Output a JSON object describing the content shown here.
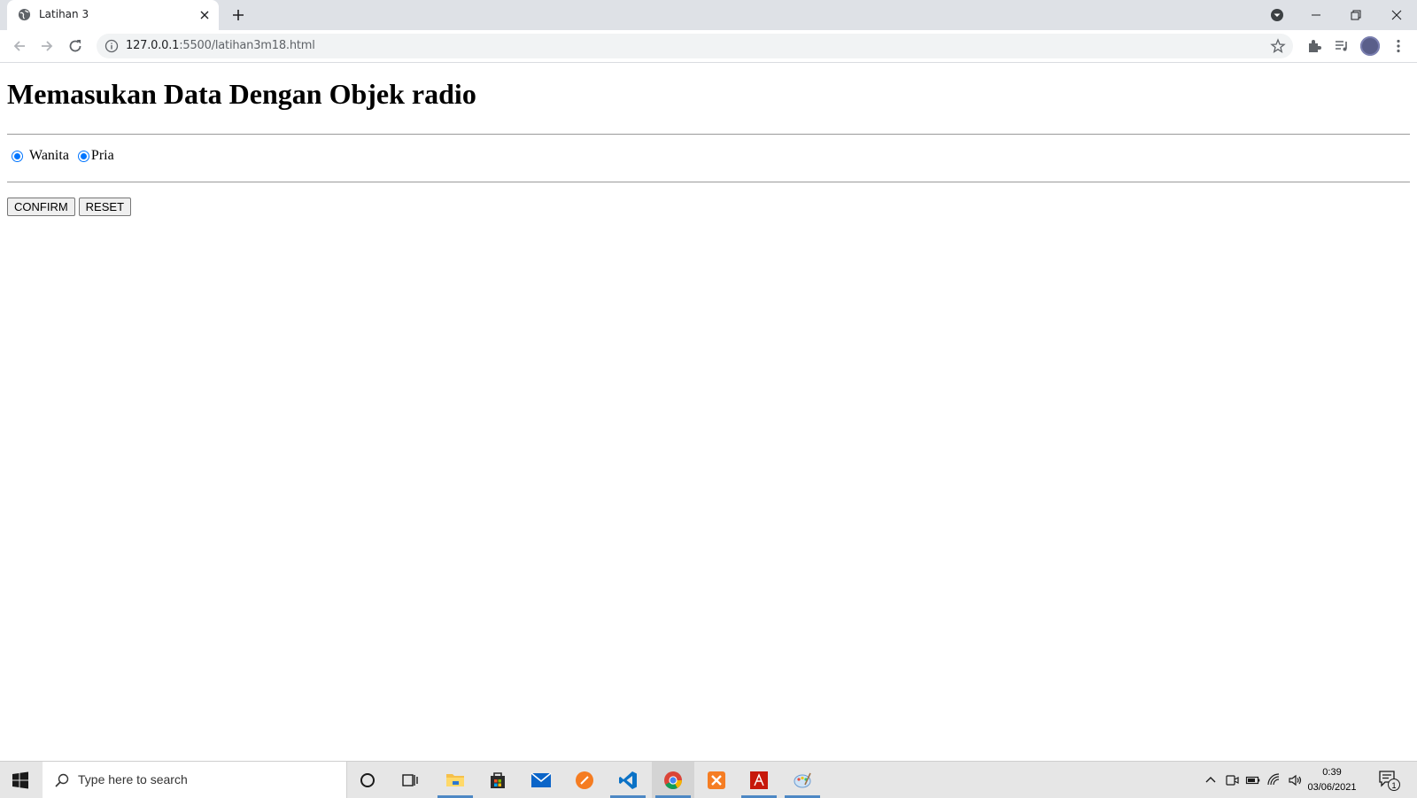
{
  "browser": {
    "tab_title": "Latihan 3",
    "url_host": "127.0.0.1",
    "url_rest": ":5500/latihan3m18.html"
  },
  "page": {
    "heading": "Memasukan Data Dengan Objek radio",
    "radios": [
      {
        "label": "Wanita",
        "checked": true
      },
      {
        "label": "Pria",
        "checked": true
      }
    ],
    "confirm_label": "CONFIRM",
    "reset_label": "RESET"
  },
  "taskbar": {
    "search_placeholder": "Type here to search",
    "time": "0:39",
    "date": "03/06/2021",
    "notification_count": "1",
    "apps": [
      "cortana-icon",
      "task-view-icon",
      "file-explorer-icon",
      "store-icon",
      "mail-icon",
      "sublime-icon",
      "vscode-icon",
      "chrome-icon",
      "xampp-icon",
      "acrobat-icon",
      "paint-icon"
    ]
  },
  "colors": {
    "accent": "#0075ff",
    "tabstrip": "#dee1e6",
    "taskbar": "#e6e6e6"
  }
}
